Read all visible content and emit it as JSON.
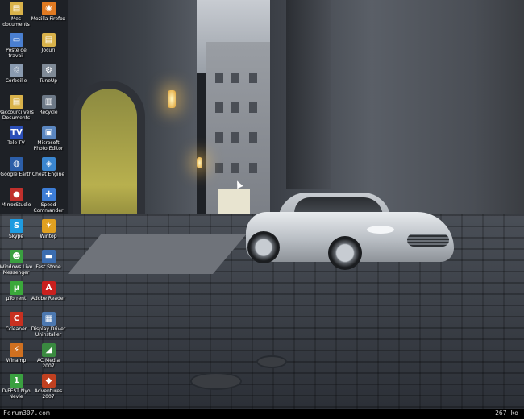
{
  "desktop_icons": [
    {
      "label": "Mes documents",
      "icon": "folder-icon",
      "color": "#d9b24a",
      "glyph": "▤"
    },
    {
      "label": "Mozilla Firefox",
      "icon": "firefox-icon",
      "color": "#e07a22",
      "glyph": "◉"
    },
    {
      "label": "Poste de travail",
      "icon": "computer-icon",
      "color": "#4a7fd0",
      "glyph": "▭"
    },
    {
      "label": "Jocuri",
      "icon": "folder-icon",
      "color": "#d9b24a",
      "glyph": "▤"
    },
    {
      "label": "Corbeille",
      "icon": "recycle-bin-icon",
      "color": "#8a9bb0",
      "glyph": "♲"
    },
    {
      "label": "TuneUp",
      "icon": "tuneup-icon",
      "color": "#7f8a96",
      "glyph": "⚙"
    },
    {
      "label": "Raccourci vers Documents",
      "icon": "folder-icon",
      "color": "#d9b24a",
      "glyph": "▤"
    },
    {
      "label": "Recycle",
      "icon": "bin-icon",
      "color": "#6c7886",
      "glyph": "▥"
    },
    {
      "label": "Tele TV",
      "icon": "tv-icon",
      "color": "#2b4fb8",
      "glyph": "TV"
    },
    {
      "label": "Microsoft Photo Editor",
      "icon": "photo-editor-icon",
      "color": "#5a86c0",
      "glyph": "▣"
    },
    {
      "label": "Google Earth",
      "icon": "google-earth-icon",
      "color": "#2c5ea8",
      "glyph": "◍"
    },
    {
      "label": "Cheat Engine",
      "icon": "cheat-engine-icon",
      "color": "#3a86d0",
      "glyph": "◈"
    },
    {
      "label": "MirrorStudio",
      "icon": "mirror-studio-icon",
      "color": "#c0302c",
      "glyph": "●"
    },
    {
      "label": "Speed Commander",
      "icon": "commander-icon",
      "color": "#3d7dd6",
      "glyph": "✚"
    },
    {
      "label": "Skype",
      "icon": "skype-icon",
      "color": "#1e9be0",
      "glyph": "S"
    },
    {
      "label": "Wintop",
      "icon": "wintop-icon",
      "color": "#e0a020",
      "glyph": "✶"
    },
    {
      "label": "Windows Live Messenger",
      "icon": "messenger-icon",
      "color": "#3aa040",
      "glyph": "☻"
    },
    {
      "label": "Fast Stone",
      "icon": "fast-stone-icon",
      "color": "#3b6db0",
      "glyph": "▬"
    },
    {
      "label": "µTorrent",
      "icon": "utorrent-icon",
      "color": "#3aa83a",
      "glyph": "µ"
    },
    {
      "label": "Adobe Reader",
      "icon": "adobe-reader-icon",
      "color": "#c8201e",
      "glyph": "A"
    },
    {
      "label": "Ccleaner",
      "icon": "ccleaner-icon",
      "color": "#c83020",
      "glyph": "C"
    },
    {
      "label": "Display Driver Uninstaller",
      "icon": "driver-icon",
      "color": "#4c78b0",
      "glyph": "▦"
    },
    {
      "label": "Winamp",
      "icon": "winamp-icon",
      "color": "#d07020",
      "glyph": "⚡"
    },
    {
      "label": "AC Media 2007",
      "icon": "ac-media-icon",
      "color": "#3a8a40",
      "glyph": "◢"
    },
    {
      "label": "D-FEST Nyo Nevle",
      "icon": "dfest-icon",
      "color": "#3aa040",
      "glyph": "1"
    },
    {
      "label": "Adventures 2007",
      "icon": "adventures-icon",
      "color": "#c04020",
      "glyph": "◆"
    }
  ],
  "taskbar": {
    "left_text": "Forum307.com",
    "right_text": "267 ko"
  }
}
